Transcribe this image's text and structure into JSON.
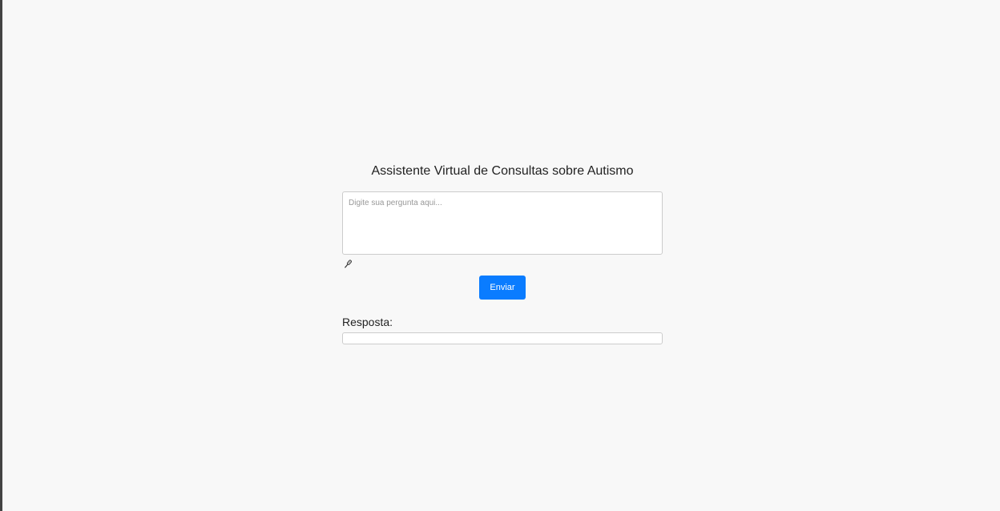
{
  "page": {
    "title": "Assistente Virtual de Consultas sobre Autismo"
  },
  "question": {
    "placeholder": "Digite sua pergunta aqui...",
    "value": ""
  },
  "mic": {
    "icon": "microphone-icon"
  },
  "send_button": {
    "label": "Enviar",
    "color": "#0a7cff"
  },
  "answer": {
    "label": "Resposta:",
    "value": ""
  }
}
